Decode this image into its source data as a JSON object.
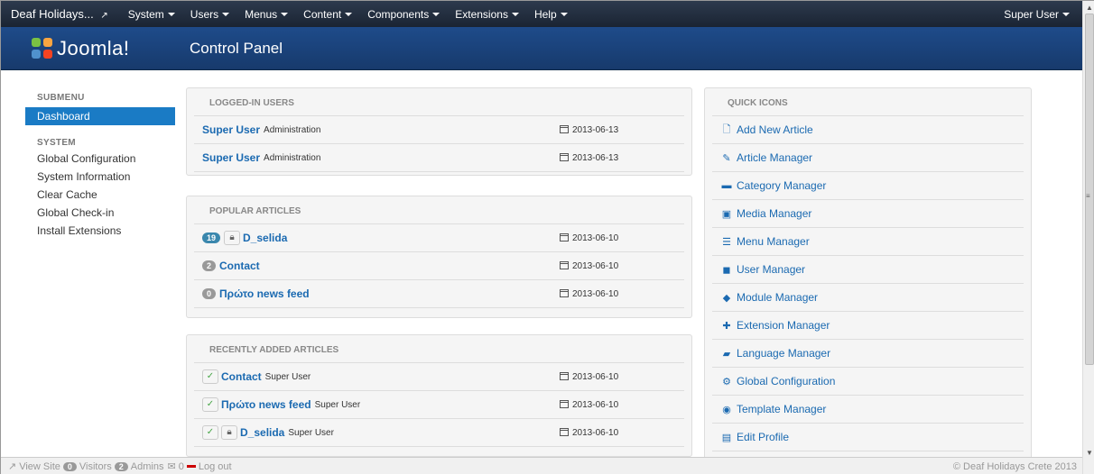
{
  "topnav": {
    "site": "Deaf Holidays...",
    "menus": [
      "System",
      "Users",
      "Menus",
      "Content",
      "Components",
      "Extensions",
      "Help"
    ],
    "user": "Super User"
  },
  "header": {
    "logo_text": "Joomla!",
    "title": "Control Panel"
  },
  "sidebar": {
    "submenu_heading": "SUBMENU",
    "active_item": "Dashboard",
    "system_heading": "SYSTEM",
    "items": [
      "Global Configuration",
      "System Information",
      "Clear Cache",
      "Global Check-in",
      "Install Extensions"
    ]
  },
  "logged_in": {
    "heading": "LOGGED-IN USERS",
    "rows": [
      {
        "name": "Super User",
        "role": "Administration",
        "date": "2013-06-13"
      },
      {
        "name": "Super User",
        "role": "Administration",
        "date": "2013-06-13"
      }
    ]
  },
  "popular": {
    "heading": "POPULAR ARTICLES",
    "rows": [
      {
        "hits": "19",
        "title": "D_selida",
        "date": "2013-06-10"
      },
      {
        "hits": "2",
        "title": "Contact",
        "date": "2013-06-10"
      },
      {
        "hits": "0",
        "title": "Πρώτο news feed",
        "date": "2013-06-10"
      }
    ]
  },
  "recent": {
    "heading": "RECENTLY ADDED ARTICLES",
    "rows": [
      {
        "title": "Contact",
        "author": "Super User",
        "date": "2013-06-10"
      },
      {
        "title": "Πρώτο news feed",
        "author": "Super User",
        "date": "2013-06-10"
      },
      {
        "title": "D_selida",
        "author": "Super User",
        "date": "2013-06-10"
      }
    ]
  },
  "quick_icons": {
    "heading": "QUICK ICONS",
    "items": [
      {
        "label": "Add New Article",
        "icon": "new-article-icon"
      },
      {
        "label": "Article Manager",
        "icon": "pencil-icon"
      },
      {
        "label": "Category Manager",
        "icon": "folder-icon"
      },
      {
        "label": "Media Manager",
        "icon": "image-icon"
      },
      {
        "label": "Menu Manager",
        "icon": "list-icon"
      },
      {
        "label": "User Manager",
        "icon": "user-icon"
      },
      {
        "label": "Module Manager",
        "icon": "cube-icon"
      },
      {
        "label": "Extension Manager",
        "icon": "puzzle-icon"
      },
      {
        "label": "Language Manager",
        "icon": "comment-icon"
      },
      {
        "label": "Global Configuration",
        "icon": "gear-icon"
      },
      {
        "label": "Template Manager",
        "icon": "eye-icon"
      },
      {
        "label": "Edit Profile",
        "icon": "vcard-icon"
      }
    ]
  },
  "footer": {
    "view_site": "View Site",
    "visitors_count": "0",
    "visitors": "Visitors",
    "admins_count": "2",
    "admins": "Admins",
    "messages_count": "0",
    "logout": "Log out",
    "copyright": "© Deaf Holidays Crete 2013"
  },
  "colors": {
    "accent": "#1a7bc5",
    "link": "#1b6ab1",
    "header": "#1e4b8a"
  }
}
